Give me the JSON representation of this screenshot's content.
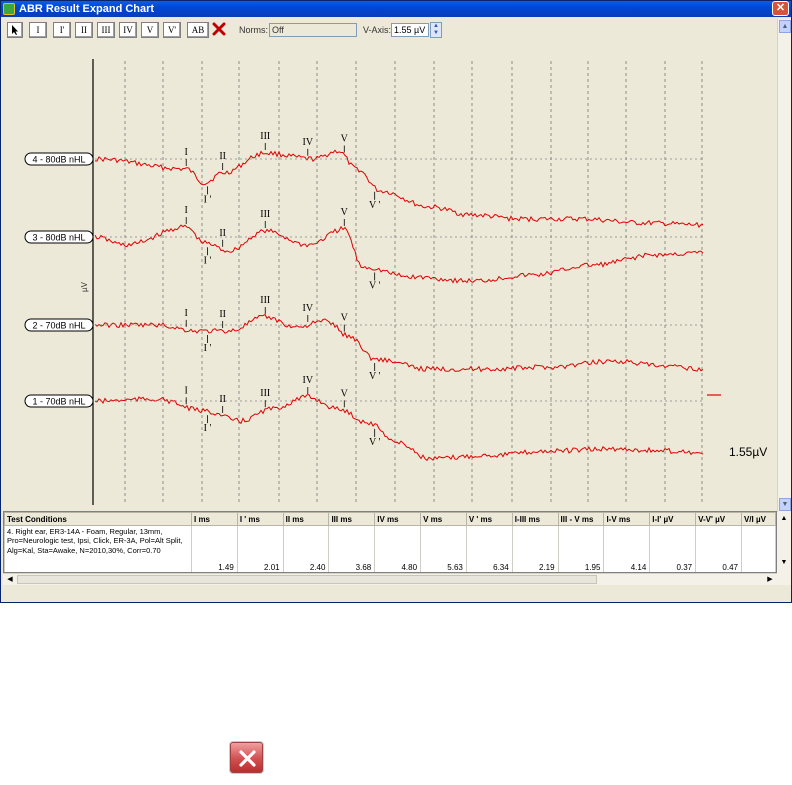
{
  "window": {
    "title": "ABR Result Expand Chart",
    "close_glyph": "✕"
  },
  "toolbar": {
    "buttons": [
      "I",
      "I'",
      "II",
      "III",
      "IV",
      "V",
      "V'",
      "AB"
    ],
    "norms_label": "Norms:",
    "norms_value": "Off",
    "vaxis_label": "V-Axis:",
    "vaxis_value": "1.55 µV"
  },
  "chart": {
    "y_unit": "µV",
    "scale_label": "1.55µV",
    "traces": [
      {
        "label": "4 - 80dB nHL",
        "color": "#e00000",
        "peaks": [
          [
            "I",
            "I"
          ],
          [
            "I'",
            "I '"
          ],
          [
            "II",
            "II"
          ],
          [
            "III",
            "III"
          ],
          [
            "IV",
            "IV"
          ],
          [
            "V",
            "V"
          ],
          [
            "V'",
            "V '"
          ]
        ]
      },
      {
        "label": "3 - 80dB nHL",
        "color": "#e00000",
        "peaks": [
          [
            "I",
            "I"
          ],
          [
            "I'",
            "I '"
          ],
          [
            "II",
            "II"
          ],
          [
            "III",
            "III"
          ],
          [
            "V",
            "V"
          ],
          [
            "V'",
            "V '"
          ]
        ]
      },
      {
        "label": "2 - 70dB nHL",
        "color": "#e00000",
        "peaks": [
          [
            "I",
            "I"
          ],
          [
            "I'",
            "I '"
          ],
          [
            "II",
            "II"
          ],
          [
            "III",
            "III"
          ],
          [
            "IV",
            "IV"
          ],
          [
            "V",
            "V"
          ],
          [
            "V'",
            "V '"
          ]
        ]
      },
      {
        "label": "1 - 70dB nHL",
        "color": "#e00000",
        "peaks": [
          [
            "I",
            "I"
          ],
          [
            "I'",
            "I '"
          ],
          [
            "II",
            "II"
          ],
          [
            "III",
            "III"
          ],
          [
            "IV",
            "IV"
          ],
          [
            "V",
            "V"
          ],
          [
            "V'",
            "V '"
          ]
        ]
      }
    ]
  },
  "table": {
    "headers": [
      "Test Conditions",
      "I ms",
      "I ' ms",
      "II ms",
      "III ms",
      "IV ms",
      "V ms",
      "V ' ms",
      "I-III ms",
      "III - V ms",
      "I-V ms",
      "I-I' µV",
      "V-V' µV",
      "V/I µV"
    ],
    "rows": [
      {
        "conditions": "4. Right ear, ER3-14A - Foam, Regular, 13mm, Pro=Neurologic test, Ipsi, Click, ER-3A, Pol=Alt Split, Alg=Kal, Sta=Awake, N=2010,30%, Corr=0.70",
        "values": [
          "1.49",
          "2.01",
          "2.40",
          "3.68",
          "4.80",
          "5.63",
          "6.34",
          "2.19",
          "1.95",
          "4.14",
          "0.37",
          "0.47",
          ""
        ]
      }
    ]
  },
  "dialog_close_icon": "close-icon"
}
